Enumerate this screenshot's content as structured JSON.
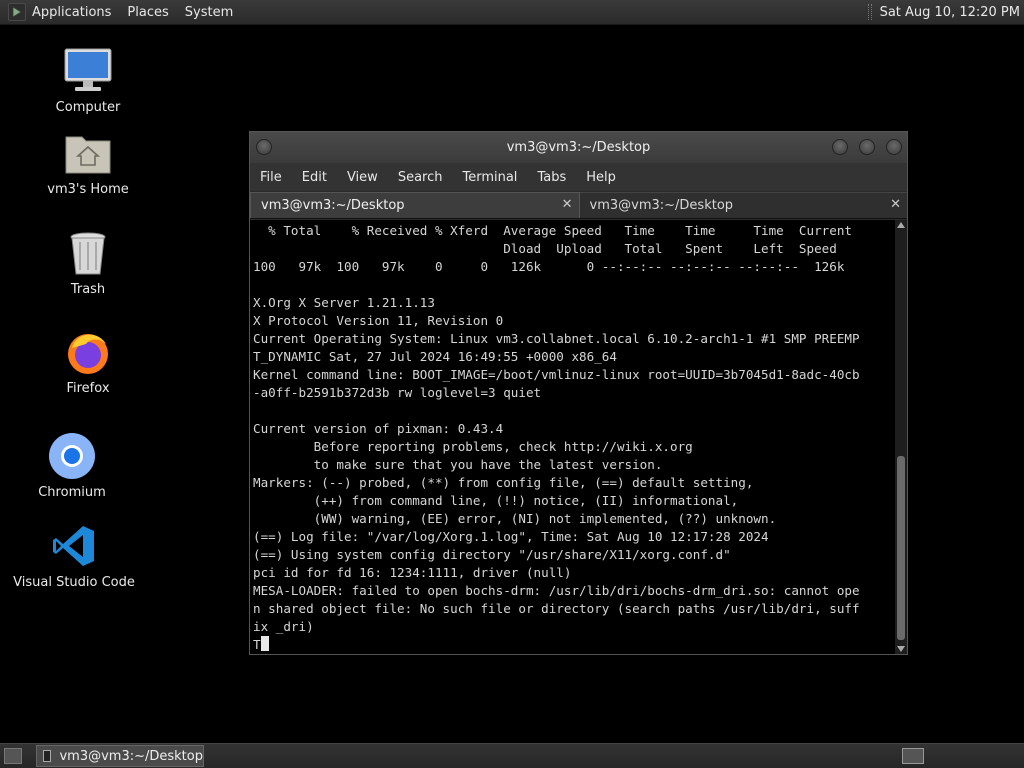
{
  "top_panel": {
    "menus": [
      "Applications",
      "Places",
      "System"
    ],
    "clock": "Sat Aug 10, 12:20 PM"
  },
  "desktop_icons": [
    {
      "label": "Computer",
      "icon": "computer-icon"
    },
    {
      "label": "vm3's Home",
      "icon": "home-folder-icon"
    },
    {
      "label": "Trash",
      "icon": "trash-icon"
    },
    {
      "label": "Firefox",
      "icon": "firefox-icon"
    },
    {
      "label": "Chromium",
      "icon": "chromium-icon"
    },
    {
      "label": "Visual Studio Code",
      "icon": "vscode-icon"
    }
  ],
  "terminal": {
    "title": "vm3@vm3:~/Desktop",
    "menus": [
      "File",
      "Edit",
      "View",
      "Search",
      "Terminal",
      "Tabs",
      "Help"
    ],
    "tabs": [
      {
        "label": "vm3@vm3:~/Desktop",
        "active": true
      },
      {
        "label": "vm3@vm3:~/Desktop",
        "active": false
      }
    ],
    "lines": [
      "  % Total    % Received % Xferd  Average Speed   Time    Time     Time  Current",
      "                                 Dload  Upload   Total   Spent    Left  Speed",
      "100   97k  100   97k    0     0   126k      0 --:--:-- --:--:-- --:--:--  126k",
      "",
      "X.Org X Server 1.21.1.13",
      "X Protocol Version 11, Revision 0",
      "Current Operating System: Linux vm3.collabnet.local 6.10.2-arch1-1 #1 SMP PREEMP",
      "T_DYNAMIC Sat, 27 Jul 2024 16:49:55 +0000 x86_64",
      "Kernel command line: BOOT_IMAGE=/boot/vmlinuz-linux root=UUID=3b7045d1-8adc-40cb",
      "-a0ff-b2591b372d3b rw loglevel=3 quiet",
      "",
      "Current version of pixman: 0.43.4",
      "        Before reporting problems, check http://wiki.x.org",
      "        to make sure that you have the latest version.",
      "Markers: (--) probed, (**) from config file, (==) default setting,",
      "        (++) from command line, (!!) notice, (II) informational,",
      "        (WW) warning, (EE) error, (NI) not implemented, (??) unknown.",
      "(==) Log file: \"/var/log/Xorg.1.log\", Time: Sat Aug 10 12:17:28 2024",
      "(==) Using system config directory \"/usr/share/X11/xorg.conf.d\"",
      "pci id for fd 16: 1234:1111, driver (null)",
      "MESA-LOADER: failed to open bochs-drm: /usr/lib/dri/bochs-drm_dri.so: cannot ope",
      "n shared object file: No such file or directory (search paths /usr/lib/dri, suff",
      "ix _dri)"
    ],
    "prompt_line": "T"
  },
  "taskbar": {
    "task_label": "vm3@vm3:~/Desktop"
  }
}
